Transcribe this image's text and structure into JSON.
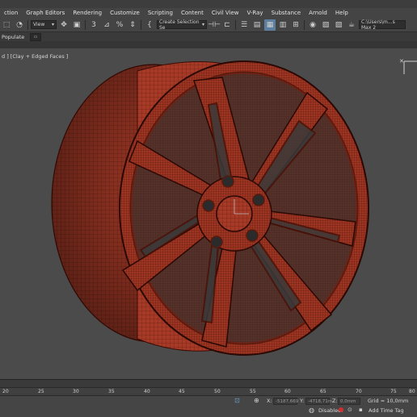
{
  "menu": {
    "items": [
      "ction",
      "Graph Editors",
      "Rendering",
      "Customize",
      "Scripting",
      "Content",
      "Civil View",
      "V-Ray",
      "Substance",
      "Arnold",
      "Help"
    ]
  },
  "toolbar": {
    "view_dropdown": "View",
    "selection_set_dropdown": "Create Selection Se",
    "path_field": "C:\\Users\\m...s Max 2"
  },
  "ribbon": {
    "populate_label": "Populate"
  },
  "viewport": {
    "label": "d ] [Clay + Edged Faces ]"
  },
  "timeline": {
    "ticks": [
      "20",
      "25",
      "30",
      "35",
      "40",
      "45",
      "50",
      "55",
      "60",
      "65",
      "70",
      "75",
      "80"
    ]
  },
  "status": {
    "x_label": "X:",
    "x_value": "-5187,669",
    "y_label": "Y:",
    "y_value": "-4718,71m",
    "z_label": "Z:",
    "z_value": "0,0mm",
    "grid_text": "Grid = 10,0mm",
    "disabled_label": "Disabled:",
    "add_time_tag": "Add Time Tag"
  },
  "colors": {
    "wheel_fill": "#a63a27",
    "wheel_dark": "#4a1208",
    "wheel_light": "#c9553a",
    "viewport_bg": "#4b4b4b"
  }
}
